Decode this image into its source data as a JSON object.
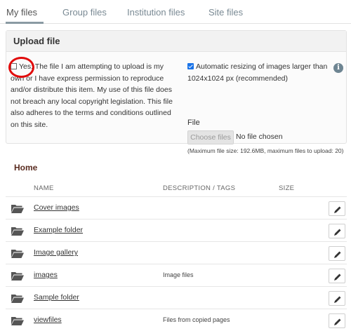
{
  "tabs": [
    {
      "label": "My files"
    },
    {
      "label": "Group files"
    },
    {
      "label": "Institution files"
    },
    {
      "label": "Site files"
    }
  ],
  "upload": {
    "title": "Upload file",
    "license_text": "Yes: The file I am attempting to upload is my own or I have express permission to reproduce and/or distribute this item. My use of this file does not breach any local copyright legislation. This file also adheres to the terms and conditions outlined on this site.",
    "resize_label": "Automatic resizing of images larger than 1024x1024 px (recommended)",
    "file_label": "File",
    "choose_button": "Choose files",
    "no_file_text": "No file chosen",
    "max_size_text": "(Maximum file size: 192.6MB, maximum files to upload: 20)",
    "info_icon": "i"
  },
  "home": {
    "title": "Home",
    "columns": {
      "name": "NAME",
      "description": "DESCRIPTION / TAGS",
      "size": "SIZE"
    },
    "folders": [
      {
        "name": "Cover images",
        "description": ""
      },
      {
        "name": "Example folder",
        "description": ""
      },
      {
        "name": "Image gallery",
        "description": ""
      },
      {
        "name": "images",
        "description": "Image files"
      },
      {
        "name": "Sample folder",
        "description": ""
      },
      {
        "name": "viewfiles",
        "description": "Files from copied pages"
      }
    ]
  },
  "colors": {
    "annotation_circle": "#e10a0a",
    "checkbox_checked": "#1a73e8",
    "folder_icon": "#555555"
  }
}
